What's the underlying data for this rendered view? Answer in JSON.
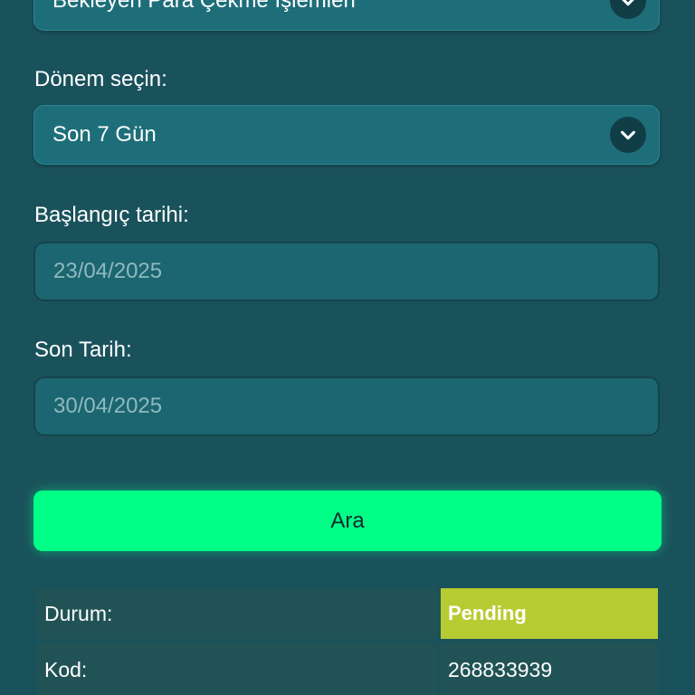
{
  "transaction_type_select": {
    "value": "Bekleyen Para Çekme İşlemleri"
  },
  "period": {
    "label": "Dönem seçin:",
    "value": "Son 7 Gün"
  },
  "start_date": {
    "label": "Başlangıç tarihi:",
    "placeholder": "23/04/2025"
  },
  "end_date": {
    "label": "Son Tarih:",
    "placeholder": "30/04/2025"
  },
  "search_button": {
    "label": "Ara"
  },
  "result": {
    "rows": [
      {
        "key": "Durum:",
        "value": "Pending"
      },
      {
        "key": "Kod:",
        "value": "268833939"
      }
    ]
  },
  "colors": {
    "background": "#1a525c",
    "button": "#00ff87",
    "status_badge": "#b7cc32"
  },
  "icons": {
    "dropdown": "chevron-down-icon"
  }
}
